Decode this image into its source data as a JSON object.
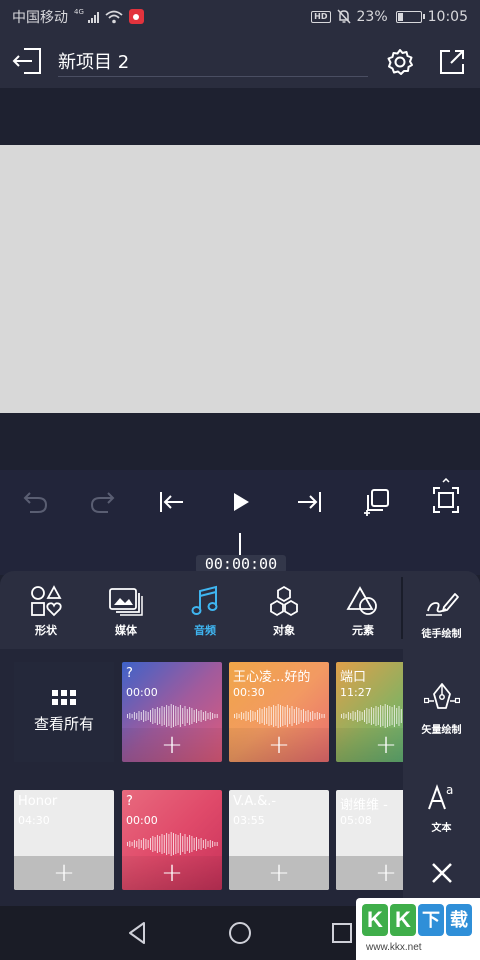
{
  "status_bar": {
    "carrier": "中国移动",
    "network": "4G",
    "hd": "HD",
    "battery_percent": "23%",
    "battery_level": 0.23,
    "time": "10:05"
  },
  "title_bar": {
    "project_name": "新项目 2"
  },
  "playback": {
    "timecode": "00:00:00"
  },
  "categories": [
    {
      "label": "形状",
      "icon": "shapes-icon"
    },
    {
      "label": "媒体",
      "icon": "media-icon"
    },
    {
      "label": "音频",
      "icon": "music-note-icon",
      "active": true
    },
    {
      "label": "对象",
      "icon": "hexagons-icon"
    },
    {
      "label": "元素",
      "icon": "elements-icon"
    }
  ],
  "side_tools": [
    {
      "label": "徒手绘制",
      "icon": "freehand-draw-icon"
    },
    {
      "label": "矢量绘制",
      "icon": "vector-pen-icon"
    },
    {
      "label": "文本",
      "icon": "text-icon"
    }
  ],
  "audio_grid": {
    "view_all_label": "查看所有",
    "row1": [
      {
        "title": "?",
        "duration": "00:00",
        "gradient": [
          "#3e63c9",
          "#a05b9d",
          "#e05b7a"
        ]
      },
      {
        "title": "王心凌...好的",
        "duration": "00:30",
        "gradient": [
          "#f0a648",
          "#f29a62",
          "#e86b6f"
        ]
      },
      {
        "title": "端口",
        "duration": "11:27",
        "gradient": [
          "#e0a04a",
          "#8bb060",
          "#4caf7d"
        ]
      }
    ],
    "row2": [
      {
        "title": "Honor",
        "duration": "04:30",
        "style": "grey"
      },
      {
        "title": "?",
        "duration": "00:00",
        "gradient": [
          "#e86a7e",
          "#e04a6a",
          "#c8325a"
        ]
      },
      {
        "title": "V.A.&.-",
        "duration": "03:55",
        "style": "grey"
      },
      {
        "title": "谢维维 -",
        "duration": "05:08",
        "style": "grey"
      }
    ],
    "add_glyph": "+"
  },
  "watermark": {
    "logo_chars": [
      "K",
      "K",
      "下",
      "载"
    ],
    "url": "www.kkx.net"
  },
  "colors": {
    "accent": "#3fb5f0",
    "panel": "#2b2e40",
    "background": "#1e2130"
  }
}
